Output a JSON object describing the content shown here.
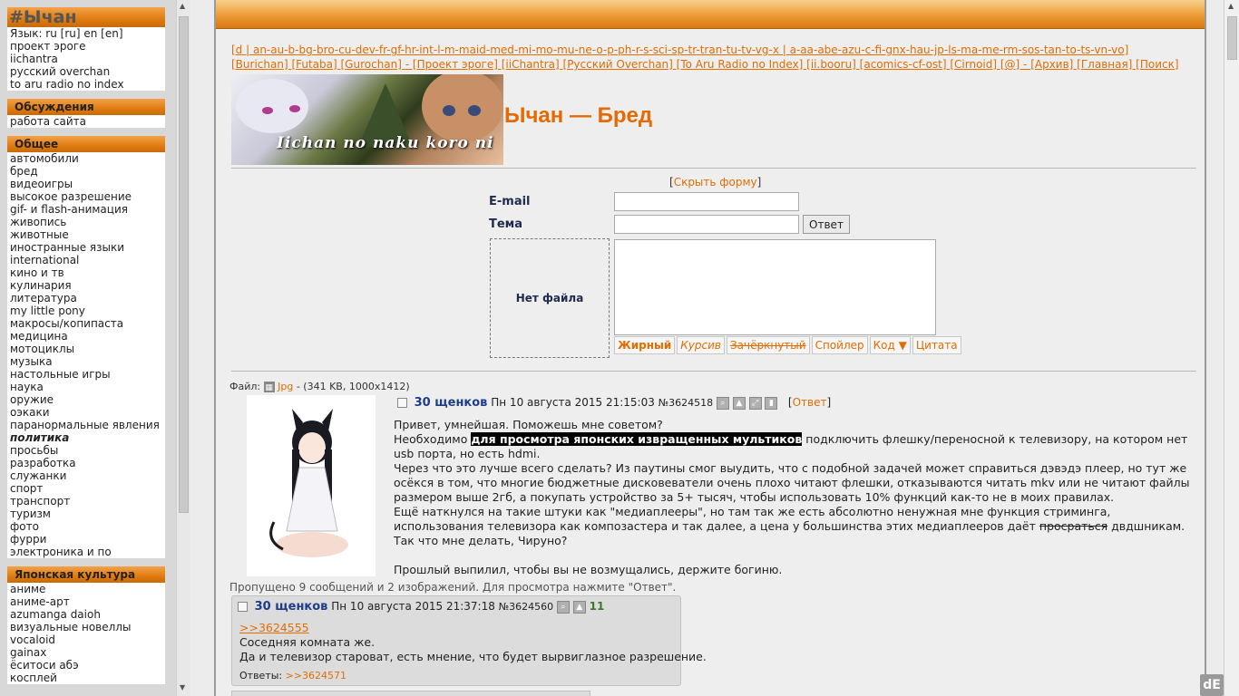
{
  "left": {
    "site": {
      "title": "#Ычан",
      "items": [
        "Язык: ru [ru] en [en]",
        "проект эроге",
        "iichantra",
        "русский overchan",
        "to aru radio no index"
      ]
    },
    "discussion": {
      "title": "Обсуждения",
      "items": [
        "работа сайта"
      ]
    },
    "general": {
      "title": "Общее",
      "items": [
        "автомобили",
        "бред",
        "видеоигры",
        "высокое разрешение",
        "gif- и flash-анимация",
        "живопись",
        "животные",
        "иностранные языки",
        "international",
        "кино и тв",
        "кулинария",
        "литература",
        "my little pony",
        "макросы/копипаста",
        "медицина",
        "мотоциклы",
        "музыка",
        "настольные игры",
        "наука",
        "оружие",
        "оэкаки",
        "паранормальные явления",
        "политика",
        "просьбы",
        "разработка",
        "служанки",
        "спорт",
        "транспорт",
        "туризм",
        "фото",
        "фурри",
        "электроника и по"
      ]
    },
    "japanese": {
      "title": "Японская культура",
      "items": [
        "аниме",
        "аниме-арт",
        "azumanga daioh",
        "визуальные новеллы",
        "vocaloid",
        "gainax",
        "ёситоси абэ",
        "косплей"
      ]
    }
  },
  "nav": {
    "line1": "[d | an-au-b-bg-bro-cu-dev-fr-gf-hr-int-l-m-maid-med-mi-mo-mu-ne-o-p-ph-r-s-sci-sp-tr-tran-tu-tv-vg-x | a-aa-abe-azu-c-fi-gnx-hau-jp-ls-ma-me-rm-sos-tan-to-ts-vn-vo]",
    "line2": "[Burichan] [Futaba] [Gurochan] - [Проект эроге] [iiChantra] [Русский Overchan] [To Aru Radio no Index] [ii.booru] [acomics-cf-ost] [Cirnoid] [@] - [Архив] [Главная] [Поиск]"
  },
  "banner": {
    "text": "Iichan no naku koro ni"
  },
  "board_title": "Ычан — Бред",
  "form": {
    "hide_form": "Скрыть форму",
    "email_label": "E-mail",
    "subject_label": "Тема",
    "submit": "Ответ",
    "no_file": "Нет файла",
    "buttons": [
      "Жирный",
      "Курсив",
      "Зачёркнутый",
      "Спойлер",
      "Код ▼",
      "Цитата"
    ]
  },
  "op": {
    "file_label": "Файл:",
    "file_type": "Jpg",
    "file_meta": "- (341 KB, 1000x1412)",
    "name": "30 щенков",
    "date": "Пн 10 августа 2015 21:15:03",
    "number": "№3624518",
    "reply_link": "Ответ",
    "line1": "Привет, умнейшая. Поможешь мне советом?",
    "line2_a": "Необходимо",
    "line2_spoiler": "для просмотра японских извращенных мультиков",
    "line2_b": "подключить флешку/переносной к телевизору, на котором нет usb порта, но есть hdmi.",
    "line3": "Через что это лучше всего сделать? Из паутины смог выудить, что с подобной задачей может справиться дэвэдэ плеер, но тут же осёкся в том, что многие бюджетные дисковеватели очень плохо читают флешки, отказываются читать mkv или не читают файлы размером выше 2гб, а покупать устройство за 5+ тысяч, чтобы использовать 10% функций как-то не в моих правилах.",
    "line4_a": "Ещё наткнулся на такие штуки как \"медиаплееры\", но там так же есть абсолютно ненужная мне функция стриминга, использования телевизора как композастера и так далее, а цена у большинства этих медиаплееров даёт",
    "line4_strike": "просраться",
    "line4_b": "двдшникам.",
    "line5": "Так что мне делать, Чируно?",
    "line6": "Прошлый выпилил, чтобы вы не возмущались, держите богиню."
  },
  "skipped": "Пропущено 9 сообщений и 2 изображений. Для просмотра нажмите \"Ответ\".",
  "reply": {
    "name": "30 щенков",
    "date": "Пн 10 августа 2015 21:37:18",
    "number": "№3624560",
    "count": "11",
    "quote_link": ">>3624555",
    "line1": "Соседняя комната же.",
    "line2": "Да и телевизор староват, есть мнение, что будет вырвиглазное разрешение.",
    "replies_label": "Ответы:",
    "replies_link": ">>3624571"
  },
  "corner_logo": "dE"
}
